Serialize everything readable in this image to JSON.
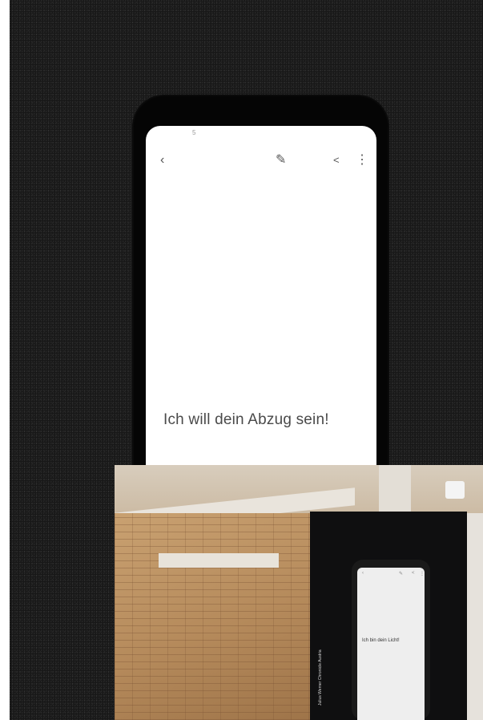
{
  "phone_screen": {
    "status_indicator": "5",
    "main_text": "Ich will dein Abzug sein!"
  },
  "inset_photo": {
    "screen_text": "Ich bin dein Licht!",
    "credit": "Julius Werner  Chronicle Austria"
  }
}
